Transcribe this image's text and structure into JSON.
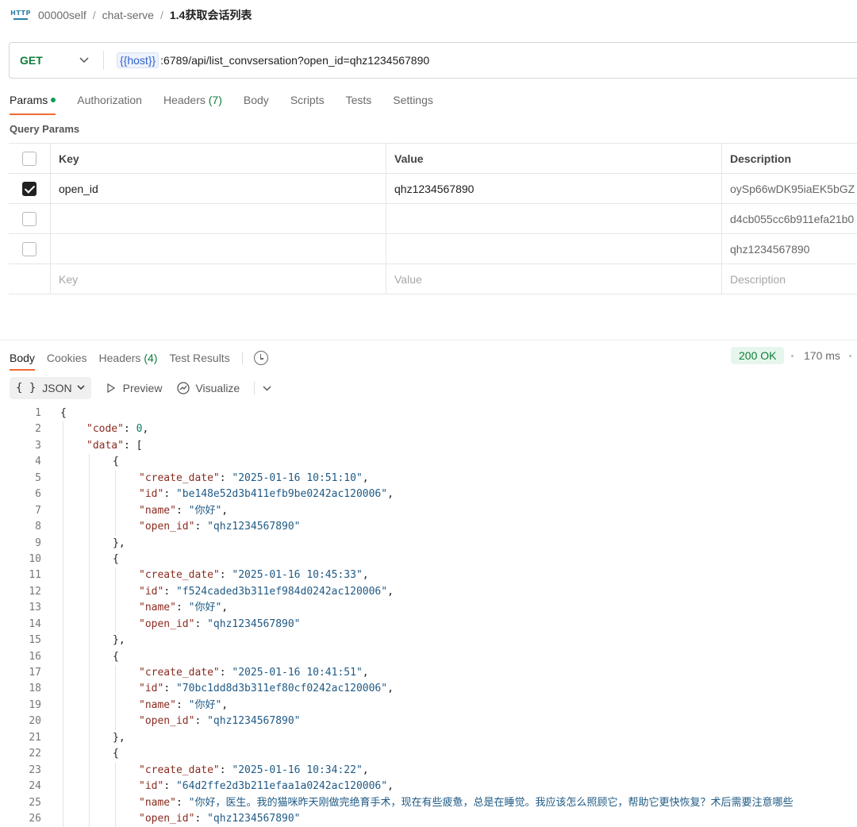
{
  "breadcrumb": {
    "icon_text": "HTTP",
    "items": [
      "00000self",
      "chat-serve"
    ],
    "separator": "/",
    "current": "1.4获取会话列表"
  },
  "request": {
    "method": "GET",
    "url_var": "{{host}}",
    "url_rest": ":6789/api/list_convsersation?open_id=qhz1234567890"
  },
  "req_tabs": [
    {
      "label": "Params",
      "active": true,
      "dot": true
    },
    {
      "label": "Authorization"
    },
    {
      "label": "Headers",
      "count": "(7)"
    },
    {
      "label": "Body"
    },
    {
      "label": "Scripts"
    },
    {
      "label": "Tests"
    },
    {
      "label": "Settings"
    }
  ],
  "query_params": {
    "title": "Query Params",
    "headers": {
      "key": "Key",
      "value": "Value",
      "description": "Description"
    },
    "rows": [
      {
        "checked": true,
        "key": "open_id",
        "value": "qhz1234567890",
        "description": "oySp66wDK95iaEK5bGZ"
      },
      {
        "checked": false,
        "key": "",
        "value": "",
        "description": "d4cb055cc6b911efa21b0"
      },
      {
        "checked": false,
        "key": "",
        "value": "",
        "description": "qhz1234567890"
      }
    ],
    "placeholder": {
      "key": "Key",
      "value": "Value",
      "description": "Description"
    }
  },
  "response": {
    "tabs": [
      {
        "label": "Body",
        "active": true
      },
      {
        "label": "Cookies"
      },
      {
        "label": "Headers",
        "count": "(4)"
      },
      {
        "label": "Test Results"
      }
    ],
    "status": "200 OK",
    "time": "170 ms",
    "format": "JSON",
    "preview_label": "Preview",
    "visualize_label": "Visualize"
  },
  "code_lines": [
    {
      "n": "1",
      "indent": 0,
      "tokens": [
        {
          "c": "jp",
          "t": "{"
        }
      ]
    },
    {
      "n": "2",
      "indent": 1,
      "tokens": [
        {
          "c": "jk",
          "t": "\"code\""
        },
        {
          "c": "jp",
          "t": ": "
        },
        {
          "c": "jn",
          "t": "0"
        },
        {
          "c": "jp",
          "t": ","
        }
      ]
    },
    {
      "n": "3",
      "indent": 1,
      "tokens": [
        {
          "c": "jk",
          "t": "\"data\""
        },
        {
          "c": "jp",
          "t": ": ["
        }
      ]
    },
    {
      "n": "4",
      "indent": 2,
      "tokens": [
        {
          "c": "jp",
          "t": "{"
        }
      ]
    },
    {
      "n": "5",
      "indent": 3,
      "tokens": [
        {
          "c": "jk",
          "t": "\"create_date\""
        },
        {
          "c": "jp",
          "t": ": "
        },
        {
          "c": "js",
          "t": "\"2025-01-16 10:51:10\""
        },
        {
          "c": "jp",
          "t": ","
        }
      ]
    },
    {
      "n": "6",
      "indent": 3,
      "tokens": [
        {
          "c": "jk",
          "t": "\"id\""
        },
        {
          "c": "jp",
          "t": ": "
        },
        {
          "c": "js",
          "t": "\"be148e52d3b411efb9be0242ac120006\""
        },
        {
          "c": "jp",
          "t": ","
        }
      ]
    },
    {
      "n": "7",
      "indent": 3,
      "tokens": [
        {
          "c": "jk",
          "t": "\"name\""
        },
        {
          "c": "jp",
          "t": ": "
        },
        {
          "c": "js",
          "t": "\"你好\""
        },
        {
          "c": "jp",
          "t": ","
        }
      ]
    },
    {
      "n": "8",
      "indent": 3,
      "tokens": [
        {
          "c": "jk",
          "t": "\"open_id\""
        },
        {
          "c": "jp",
          "t": ": "
        },
        {
          "c": "js",
          "t": "\"qhz1234567890\""
        }
      ]
    },
    {
      "n": "9",
      "indent": 2,
      "tokens": [
        {
          "c": "jp",
          "t": "},"
        }
      ]
    },
    {
      "n": "10",
      "indent": 2,
      "tokens": [
        {
          "c": "jp",
          "t": "{"
        }
      ]
    },
    {
      "n": "11",
      "indent": 3,
      "tokens": [
        {
          "c": "jk",
          "t": "\"create_date\""
        },
        {
          "c": "jp",
          "t": ": "
        },
        {
          "c": "js",
          "t": "\"2025-01-16 10:45:33\""
        },
        {
          "c": "jp",
          "t": ","
        }
      ]
    },
    {
      "n": "12",
      "indent": 3,
      "tokens": [
        {
          "c": "jk",
          "t": "\"id\""
        },
        {
          "c": "jp",
          "t": ": "
        },
        {
          "c": "js",
          "t": "\"f524caded3b311ef984d0242ac120006\""
        },
        {
          "c": "jp",
          "t": ","
        }
      ]
    },
    {
      "n": "13",
      "indent": 3,
      "tokens": [
        {
          "c": "jk",
          "t": "\"name\""
        },
        {
          "c": "jp",
          "t": ": "
        },
        {
          "c": "js",
          "t": "\"你好\""
        },
        {
          "c": "jp",
          "t": ","
        }
      ]
    },
    {
      "n": "14",
      "indent": 3,
      "tokens": [
        {
          "c": "jk",
          "t": "\"open_id\""
        },
        {
          "c": "jp",
          "t": ": "
        },
        {
          "c": "js",
          "t": "\"qhz1234567890\""
        }
      ]
    },
    {
      "n": "15",
      "indent": 2,
      "tokens": [
        {
          "c": "jp",
          "t": "},"
        }
      ]
    },
    {
      "n": "16",
      "indent": 2,
      "tokens": [
        {
          "c": "jp",
          "t": "{"
        }
      ]
    },
    {
      "n": "17",
      "indent": 3,
      "tokens": [
        {
          "c": "jk",
          "t": "\"create_date\""
        },
        {
          "c": "jp",
          "t": ": "
        },
        {
          "c": "js",
          "t": "\"2025-01-16 10:41:51\""
        },
        {
          "c": "jp",
          "t": ","
        }
      ]
    },
    {
      "n": "18",
      "indent": 3,
      "tokens": [
        {
          "c": "jk",
          "t": "\"id\""
        },
        {
          "c": "jp",
          "t": ": "
        },
        {
          "c": "js",
          "t": "\"70bc1dd8d3b311ef80cf0242ac120006\""
        },
        {
          "c": "jp",
          "t": ","
        }
      ]
    },
    {
      "n": "19",
      "indent": 3,
      "tokens": [
        {
          "c": "jk",
          "t": "\"name\""
        },
        {
          "c": "jp",
          "t": ": "
        },
        {
          "c": "js",
          "t": "\"你好\""
        },
        {
          "c": "jp",
          "t": ","
        }
      ]
    },
    {
      "n": "20",
      "indent": 3,
      "tokens": [
        {
          "c": "jk",
          "t": "\"open_id\""
        },
        {
          "c": "jp",
          "t": ": "
        },
        {
          "c": "js",
          "t": "\"qhz1234567890\""
        }
      ]
    },
    {
      "n": "21",
      "indent": 2,
      "tokens": [
        {
          "c": "jp",
          "t": "},"
        }
      ]
    },
    {
      "n": "22",
      "indent": 2,
      "tokens": [
        {
          "c": "jp",
          "t": "{"
        }
      ]
    },
    {
      "n": "23",
      "indent": 3,
      "tokens": [
        {
          "c": "jk",
          "t": "\"create_date\""
        },
        {
          "c": "jp",
          "t": ": "
        },
        {
          "c": "js",
          "t": "\"2025-01-16 10:34:22\""
        },
        {
          "c": "jp",
          "t": ","
        }
      ]
    },
    {
      "n": "24",
      "indent": 3,
      "tokens": [
        {
          "c": "jk",
          "t": "\"id\""
        },
        {
          "c": "jp",
          "t": ": "
        },
        {
          "c": "js",
          "t": "\"64d2ffe2d3b211efaa1a0242ac120006\""
        },
        {
          "c": "jp",
          "t": ","
        }
      ]
    },
    {
      "n": "25",
      "indent": 3,
      "tokens": [
        {
          "c": "jk",
          "t": "\"name\""
        },
        {
          "c": "jp",
          "t": ": "
        },
        {
          "c": "js",
          "t": "\"你好，医生。我的猫咪昨天刚做完绝育手术，现在有些疲惫，总是在睡觉。我应该怎么照顾它，帮助它更快恢复？术后需要注意哪些"
        }
      ]
    },
    {
      "n": "26",
      "indent": 3,
      "tokens": [
        {
          "c": "jk",
          "t": "\"open_id\""
        },
        {
          "c": "jp",
          "t": ": "
        },
        {
          "c": "js",
          "t": "\"qhz1234567890\""
        }
      ]
    }
  ]
}
